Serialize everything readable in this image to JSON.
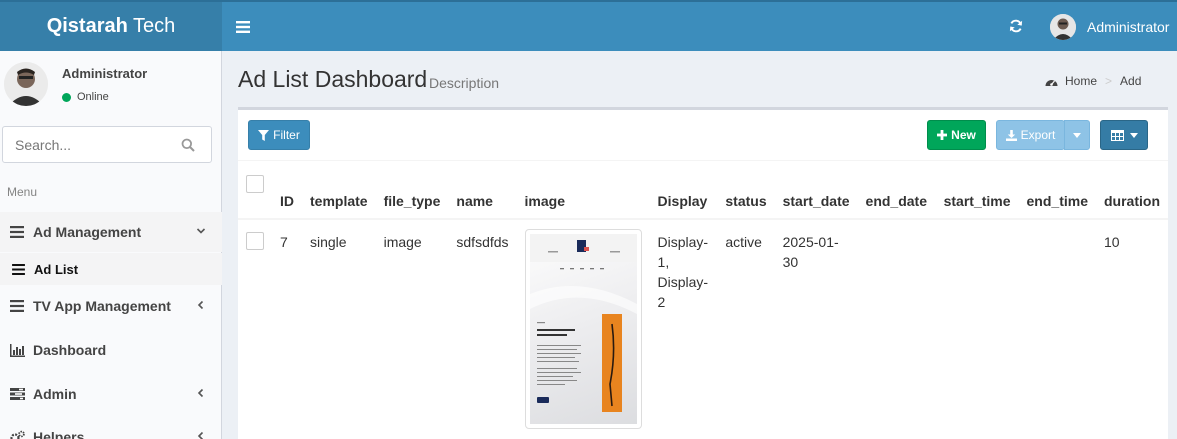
{
  "header": {
    "brand_bold": "Qistarah",
    "brand_rest": " Tech",
    "user_name": "Administrator"
  },
  "sidebar": {
    "user": {
      "name": "Administrator",
      "status": "Online"
    },
    "search": {
      "placeholder": "Search..."
    },
    "menu_header": "Menu",
    "items": [
      {
        "label": "Ad Management",
        "icon": "bars-icon",
        "caret": "chevron-down"
      },
      {
        "label": "Ad List",
        "icon": "bars-icon"
      },
      {
        "label": "TV App Management",
        "icon": "bars-icon",
        "caret": "chevron-left"
      },
      {
        "label": "Dashboard",
        "icon": "bar-chart-icon"
      },
      {
        "label": "Admin",
        "icon": "tasks-icon",
        "caret": "chevron-left"
      },
      {
        "label": "Helpers",
        "icon": "gears-icon",
        "caret": "chevron-left"
      }
    ]
  },
  "content": {
    "title": "Ad List Dashboard",
    "description": "Description",
    "breadcrumb": {
      "home": "Home",
      "current": "Add"
    }
  },
  "toolbar": {
    "filter_label": "Filter",
    "new_label": "New",
    "export_label": "Export"
  },
  "table": {
    "columns": [
      "ID",
      "template",
      "file_type",
      "name",
      "image",
      "Display",
      "status",
      "start_date",
      "end_date",
      "start_time",
      "end_time",
      "duration"
    ],
    "rows": [
      {
        "id": "7",
        "template": "single",
        "file_type": "image",
        "name": "sdfsdfds",
        "display_1": "Display-1,",
        "display_2": "Display-2",
        "status": "active",
        "start_date": "2025-01-30",
        "end_date": "",
        "start_time": "",
        "end_time": "",
        "duration": "10"
      }
    ]
  },
  "colors": {
    "header": "#3c8dbc",
    "logo": "#367fa9",
    "success": "#00a65a",
    "export": "#8ec3e6",
    "columns_button": "#357ca5"
  }
}
